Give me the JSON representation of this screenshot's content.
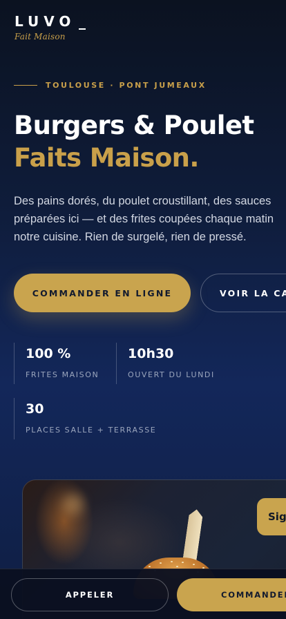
{
  "brand": {
    "name": "LUVO",
    "tagline": "Fait Maison",
    "accent_color": "#c9a44e",
    "background_color": "#13275a"
  },
  "hero": {
    "eyebrow": "TOULOUSE · PONT JUMEAUX",
    "title_line1": "Burgers & Poulet",
    "title_line2": "Faits Maison.",
    "description_lines": [
      "Des pains dorés, du poulet croustillant, des sauces",
      "préparées ici — et des frites coupées chaque matin",
      "notre cuisine. Rien de surgelé, rien de pressé."
    ],
    "cta_primary": "COMMANDER EN LIGNE",
    "cta_secondary": "VOIR LA CARTE"
  },
  "stats": [
    {
      "value": "100 %",
      "label": "FRITES MAISON"
    },
    {
      "value": "10h30",
      "label": "OUVERT DU LUNDI"
    },
    {
      "value": "30",
      "label": "PLACES SALLE + TERRASSE"
    }
  ],
  "photo": {
    "badge": "Sig"
  },
  "bottom_bar": {
    "call_label": "APPELER",
    "order_label": "COMMANDER"
  }
}
